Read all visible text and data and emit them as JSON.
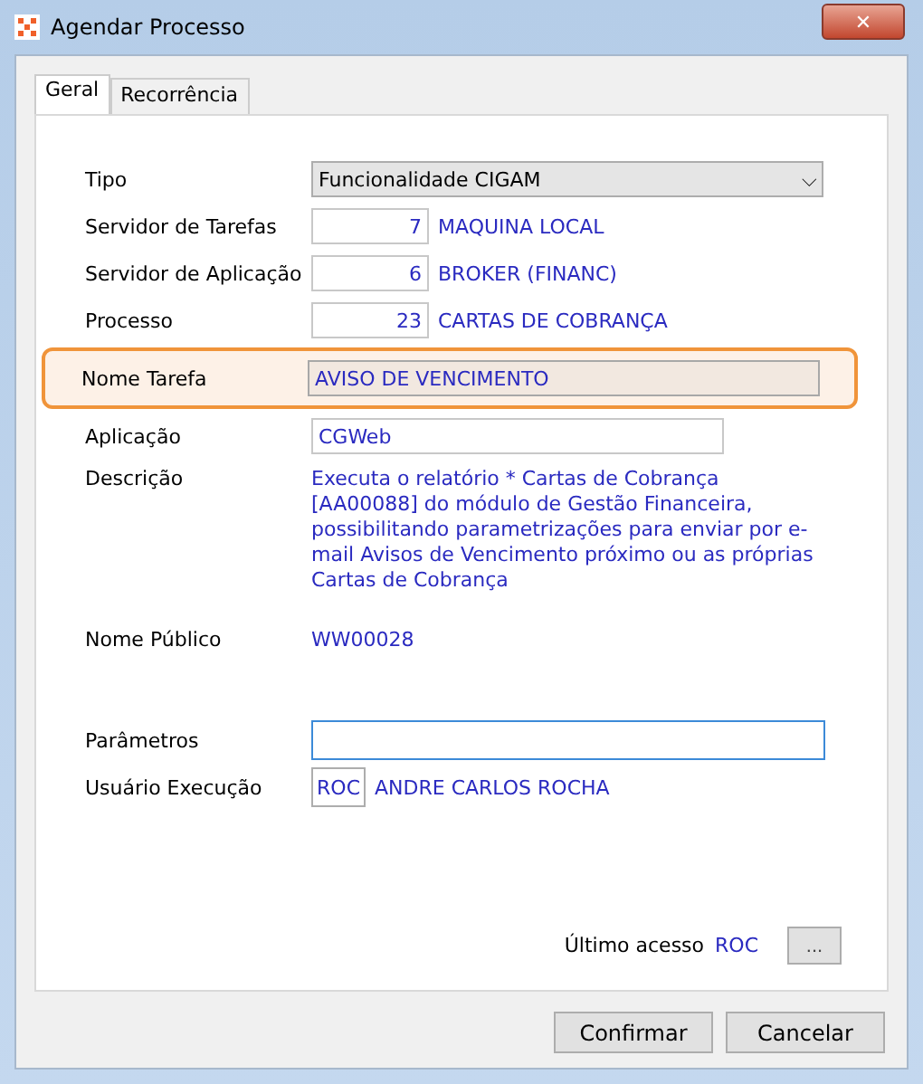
{
  "window": {
    "title": "Agendar Processo",
    "close": "✕"
  },
  "tabs": [
    {
      "label": "Geral",
      "selected": true
    },
    {
      "label": "Recorrência",
      "selected": false
    }
  ],
  "fields": [
    {
      "kind": "select",
      "label": "Tipo",
      "value": "Funcionalidade CIGAM",
      "caret": "⌵"
    },
    {
      "kind": "code",
      "label": "Servidor de Tarefas",
      "value": "7",
      "description": "MAQUINA LOCAL"
    },
    {
      "kind": "code",
      "label": "Servidor de Aplicação",
      "value": "6",
      "description": "BROKER (FINANC)"
    },
    {
      "kind": "code",
      "label": "Processo",
      "value": "23",
      "description": "CARTAS DE COBRANÇA"
    },
    {
      "kind": "readonly",
      "label": "Nome Tarefa",
      "value": "AVISO DE VENCIMENTO",
      "highlighted": true
    },
    {
      "kind": "text",
      "label": "Aplicação",
      "value": "CGWeb"
    },
    {
      "kind": "description",
      "label": "Descrição",
      "value": "Executa o relatório * Cartas de Cobrança [AA00088] do módulo de Gestão Financeira, possibilitando parametrizações para enviar por e-mail Avisos de Vencimento próximo ou as próprias Cartas de Cobrança"
    },
    {
      "kind": "plain",
      "label": "Nome Público",
      "value": "WW00028"
    },
    {
      "kind": "input",
      "label": "Parâmetros",
      "focused": true
    },
    {
      "kind": "user",
      "label": "Usuário Execução",
      "value": "ROC",
      "description": "ANDRE CARLOS ROCHA"
    }
  ],
  "last_access": {
    "label": "Último acesso",
    "value": "ROC",
    "button": "..."
  },
  "buttons": [
    "Confirmar",
    "Cancelar"
  ]
}
